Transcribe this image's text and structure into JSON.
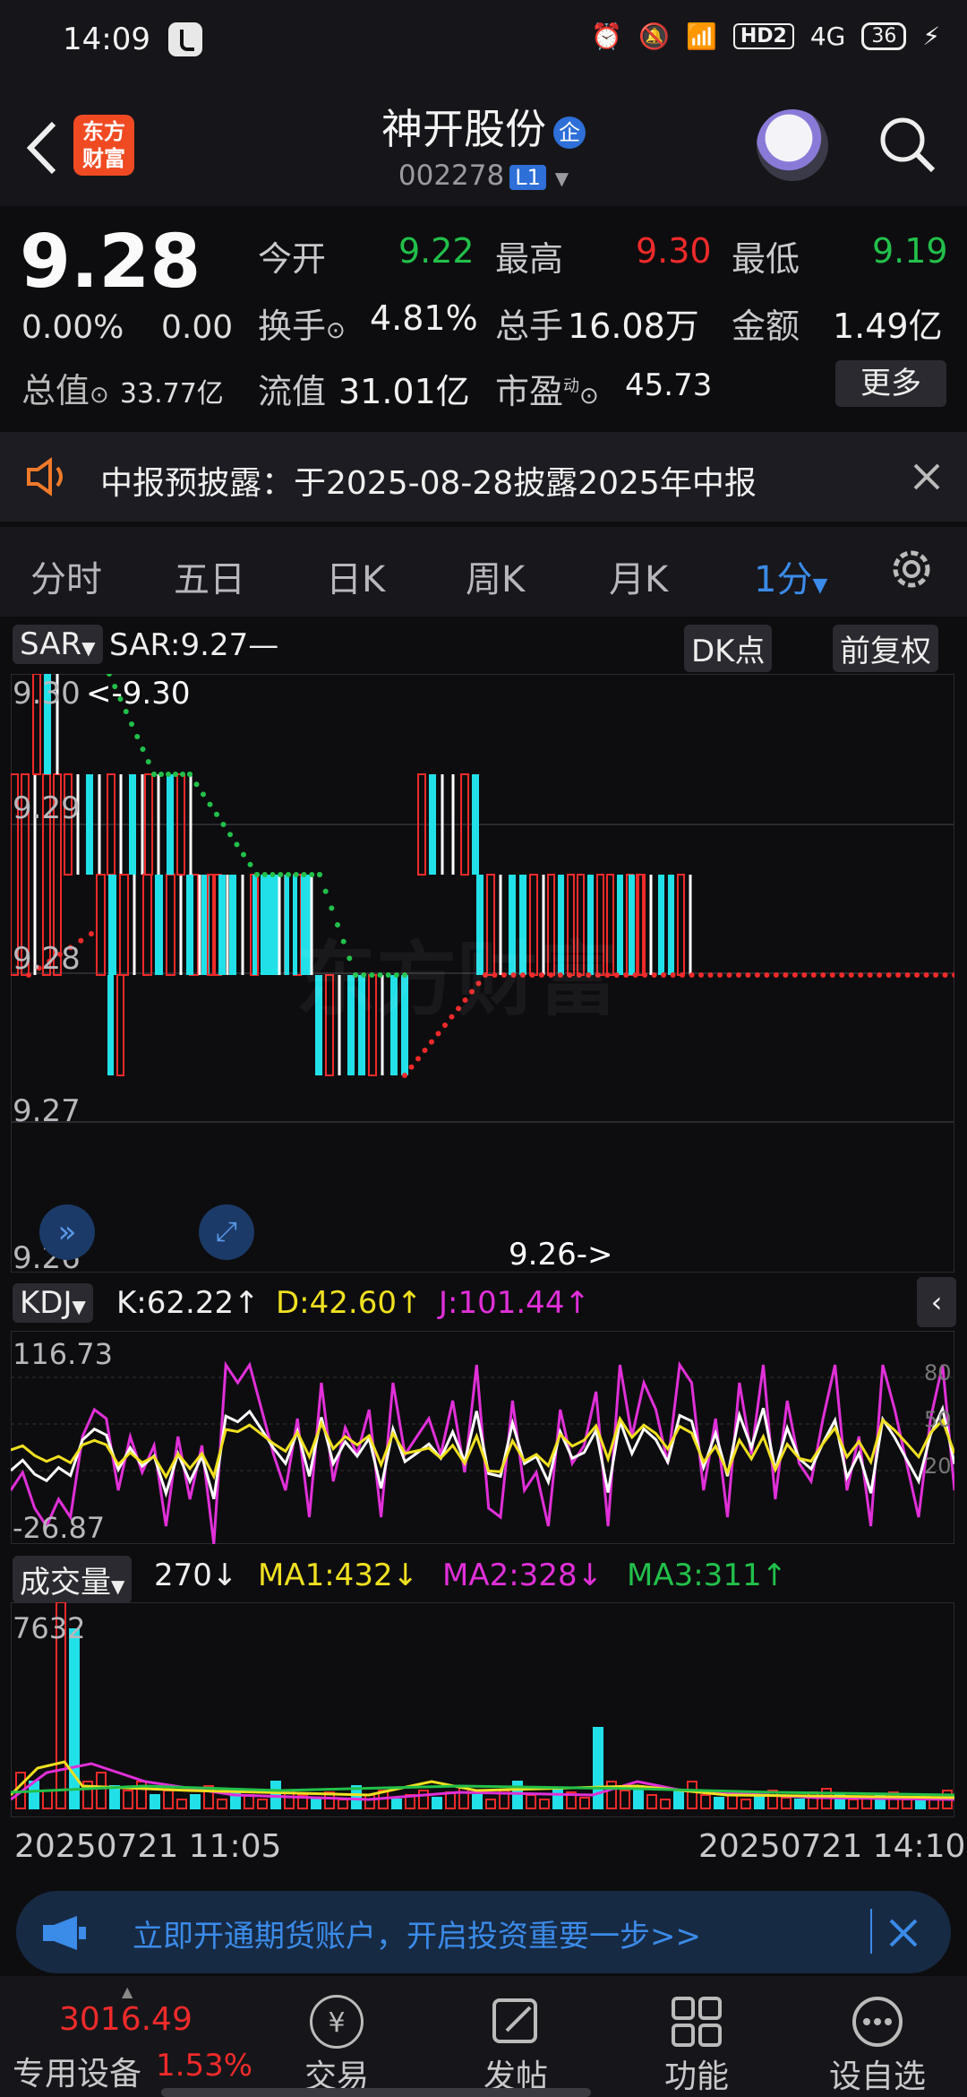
{
  "status_bar": {
    "time": "14:09",
    "hd": "HD2",
    "net": "4G",
    "battery": "36"
  },
  "header": {
    "logo_line1": "东方",
    "logo_line2": "财富",
    "stock_name": "神开股份",
    "qi_badge": "企",
    "stock_code": "002278",
    "level": "L1"
  },
  "quote": {
    "price": "9.28",
    "change_pct": "0.00%",
    "change": "0.00",
    "open_label": "今开",
    "open": "9.22",
    "high_label": "最高",
    "high": "9.30",
    "low_label": "最低",
    "low": "9.19",
    "turnover_label": "换手",
    "turnover": "4.81%",
    "volume_label": "总手",
    "volume": "16.08万",
    "amount_label": "金额",
    "amount": "1.49亿",
    "total_mv_label": "总值",
    "total_mv": "33.77亿",
    "float_mv_label": "流值",
    "float_mv": "31.01亿",
    "pe_label": "市盈",
    "pe_sup": "动",
    "pe": "45.73",
    "more_label": "更多"
  },
  "notice": {
    "text": "中报预披露：于2025-08-28披露2025年中报"
  },
  "tabs": [
    {
      "label": "分时"
    },
    {
      "label": "五日"
    },
    {
      "label": "日K"
    },
    {
      "label": "周K"
    },
    {
      "label": "月K"
    },
    {
      "label": "1分"
    }
  ],
  "indicator_bar": {
    "sar_label": "SAR",
    "sar_value": "SAR:9.27—",
    "dk_label": "DK点",
    "adjust_label": "前复权"
  },
  "price_chart": {
    "axis_labels": [
      "9.30",
      "9.29",
      "9.28",
      "9.27",
      "9.26"
    ],
    "max_marker": "<-9.30",
    "min_marker": "9.26->",
    "watermark": "东方财富"
  },
  "kdj_bar": {
    "label": "KDJ",
    "k": "K:62.22",
    "d": "D:42.60",
    "j": "J:101.44"
  },
  "kdj_chart": {
    "max": "116.73",
    "min": "-26.87",
    "levels": [
      "80",
      "50",
      "20"
    ]
  },
  "volume_bar": {
    "label": "成交量",
    "vol": "270",
    "ma1": "MA1:432",
    "ma2": "MA2:328",
    "ma3": "MA3:311"
  },
  "volume_chart": {
    "max": "7632"
  },
  "time_axis": {
    "start": "20250721 11:05",
    "end": "20250721 14:10"
  },
  "banner": {
    "text": "立即开通期货账户，开启投资重要一步>>"
  },
  "bottom_nav": {
    "index_value": "3016.49",
    "index_label": "专用设备",
    "index_pct": "1.53%",
    "items": [
      {
        "label": "交易"
      },
      {
        "label": "发帖"
      },
      {
        "label": "功能"
      },
      {
        "label": "设自选"
      }
    ]
  },
  "colors": {
    "up": "#ef2a2a",
    "down": "#22e0e8",
    "accent": "#3b8be8",
    "bg": "#0d0d0f"
  },
  "chart_data": {
    "type": "bar",
    "price_range": [
      9.26,
      9.3
    ],
    "kdj": {
      "K": 62.22,
      "D": 42.6,
      "J": 101.44,
      "range": [
        -26.87,
        116.73
      ]
    },
    "volume": {
      "last": 270,
      "MA1": 432,
      "MA2": 328,
      "MA3": 311,
      "max": 7632
    },
    "x_range": [
      "20250721 11:05",
      "20250721 14:10"
    ]
  }
}
